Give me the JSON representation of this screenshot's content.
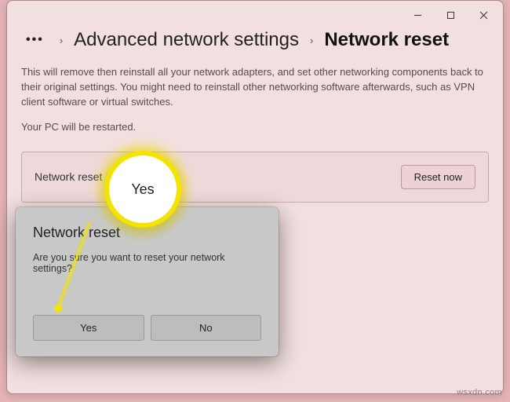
{
  "window_controls": {
    "min": "minimize",
    "max": "maximize",
    "close": "close"
  },
  "breadcrumb": {
    "more": "•••",
    "sep": "›",
    "advanced": "Advanced network settings",
    "current": "Network reset"
  },
  "page": {
    "description": "This will remove then reinstall all your network adapters, and set other networking components back to their original settings. You might need to reinstall other networking software afterwards, such as VPN client software or virtual switches.",
    "restart_note": "Your PC will be restarted.",
    "panel_label": "Network reset",
    "reset_button": "Reset now"
  },
  "dialog": {
    "title": "Network reset",
    "message": "Are you sure you want to reset your network settings?",
    "yes": "Yes",
    "no": "No"
  },
  "highlight": {
    "label": "Yes"
  },
  "watermark": "wsxdn.com"
}
